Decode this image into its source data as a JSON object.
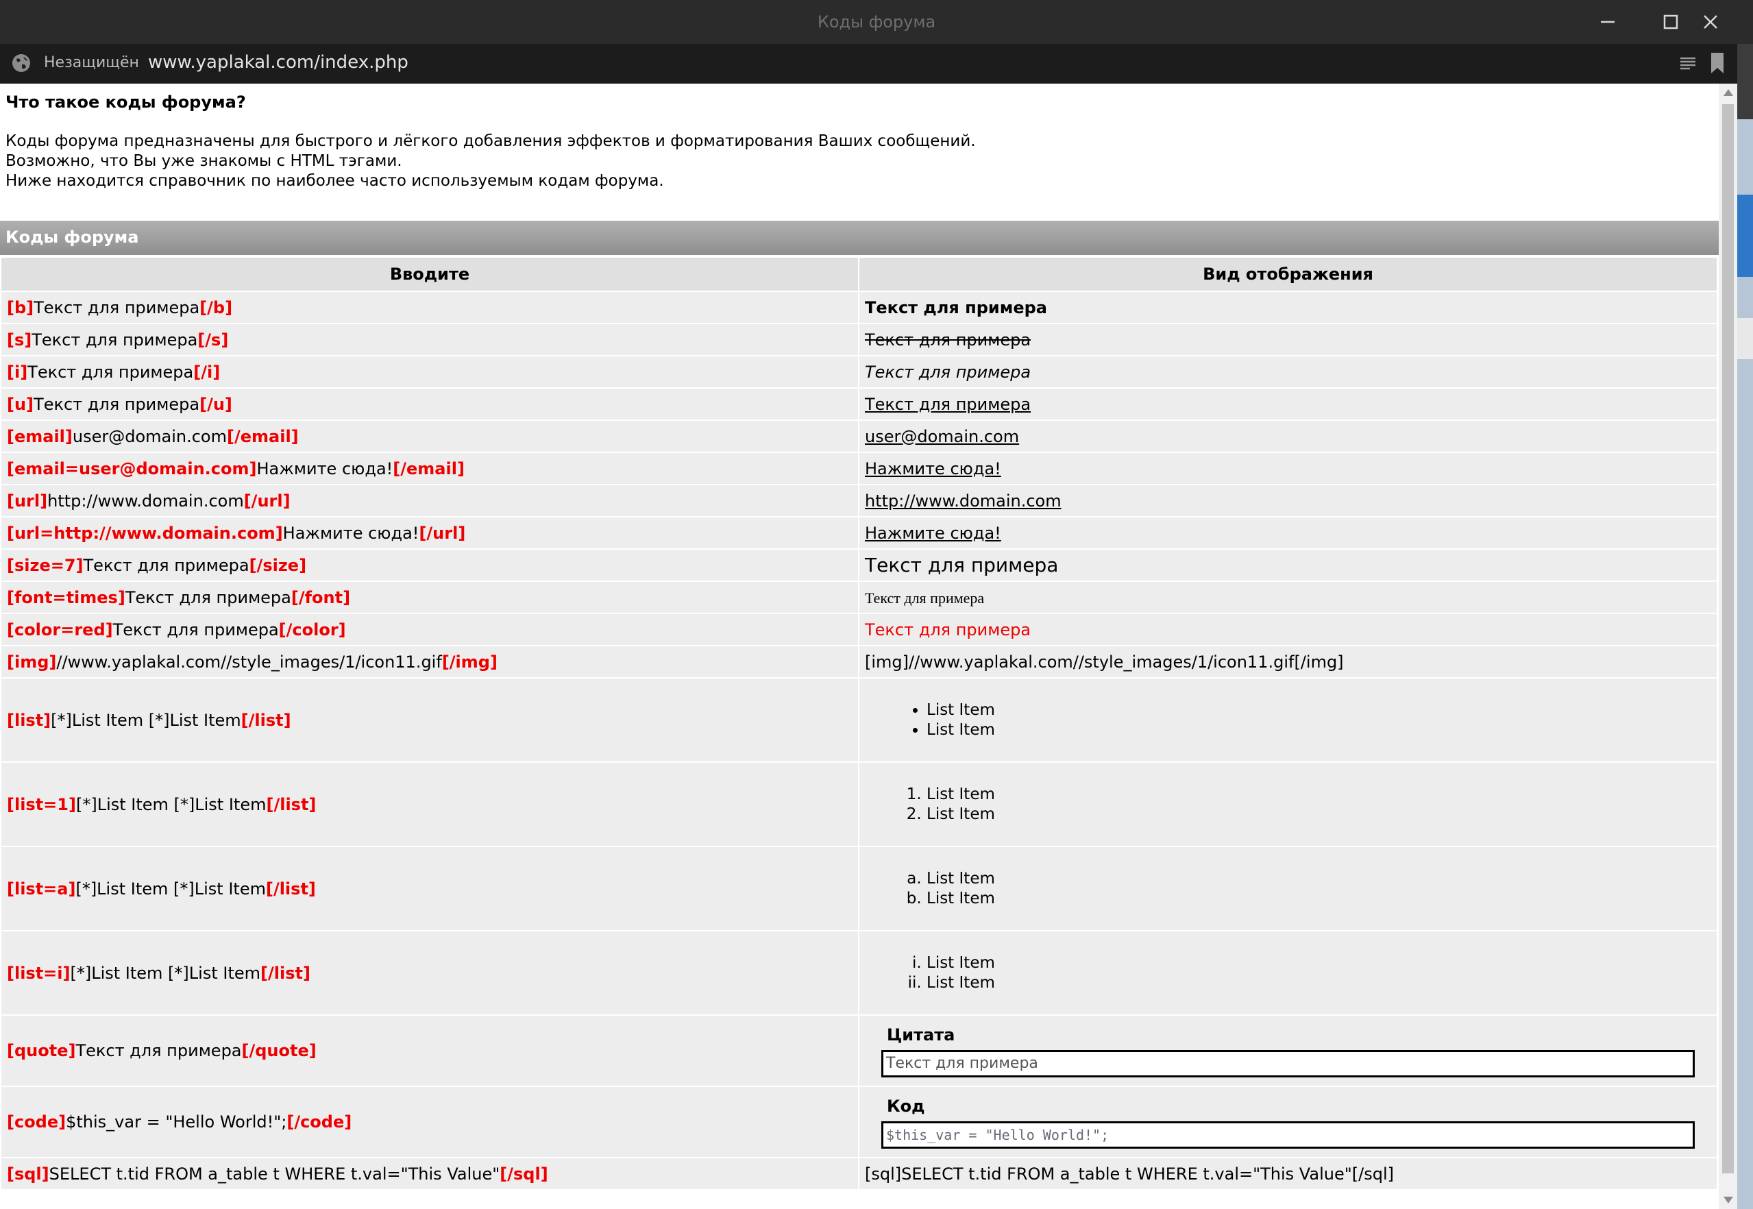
{
  "window": {
    "title": "Коды форума"
  },
  "address_bar": {
    "security_label": "Незащищён",
    "url": "www.yaplakal.com/index.php"
  },
  "intro": {
    "heading": "Что такое коды форума?",
    "paragraph_lines": [
      "Коды форума предназначены для быстрого и лёгкого добавления эффектов и форматирования Ваших сообщений.",
      "Возможно, что Вы уже знакомы с HTML тэгами.",
      "Ниже находится справочник по наиболее часто используемым кодам форума."
    ]
  },
  "section": {
    "title": "Коды форума"
  },
  "table": {
    "headers": [
      "Вводите",
      "Вид отображения"
    ],
    "rows": {
      "b": {
        "open": "[b]",
        "text": "Текст для примера",
        "close": "[/b]",
        "result": "Текст для примера"
      },
      "s": {
        "open": "[s]",
        "text": "Текст для примера",
        "close": "[/s]",
        "result": "Текст для примера"
      },
      "i": {
        "open": "[i]",
        "text": "Текст для примера",
        "close": "[/i]",
        "result": "Текст для примера"
      },
      "u": {
        "open": "[u]",
        "text": "Текст для примера",
        "close": "[/u]",
        "result": "Текст для примера"
      },
      "email1": {
        "open": "[email]",
        "text": "user@domain.com",
        "close": "[/email]",
        "result": "user@domain.com"
      },
      "email2": {
        "open": "[email=user@domain.com]",
        "text": "Нажмите сюда!",
        "close": "[/email]",
        "result": "Нажмите сюда!"
      },
      "url1": {
        "open": "[url]",
        "text": "http://www.domain.com",
        "close": "[/url]",
        "result": "http://www.domain.com"
      },
      "url2": {
        "open": "[url=http://www.domain.com]",
        "text": "Нажмите сюда!",
        "close": "[/url]",
        "result": "Нажмите сюда!"
      },
      "size": {
        "open": "[size=7]",
        "text": "Текст для примера",
        "close": "[/size]",
        "result": "Текст для примера"
      },
      "font": {
        "open": "[font=times]",
        "text": "Текст для примера",
        "close": "[/font]",
        "result": "Текст для примера"
      },
      "color": {
        "open": "[color=red]",
        "text": "Текст для примера",
        "close": "[/color]",
        "result": "Текст для примера"
      },
      "img": {
        "open": "[img]",
        "text": "//www.yaplakal.com//style_images/1/icon11.gif",
        "close": "[/img]",
        "result": "[img]//www.yaplakal.com//style_images/1/icon11.gif[/img]"
      },
      "list": {
        "open": "[list]",
        "text": "[*]List Item [*]List Item",
        "close": "[/list]",
        "items": [
          "List Item",
          "List Item"
        ]
      },
      "list1": {
        "open": "[list=1]",
        "text": "[*]List Item [*]List Item",
        "close": "[/list]",
        "items": [
          "List Item",
          "List Item"
        ]
      },
      "lista": {
        "open": "[list=a]",
        "text": "[*]List Item [*]List Item",
        "close": "[/list]",
        "items": [
          "List Item",
          "List Item"
        ]
      },
      "listi": {
        "open": "[list=i]",
        "text": "[*]List Item [*]List Item",
        "close": "[/list]",
        "items": [
          "List Item",
          "List Item"
        ]
      },
      "quote": {
        "open": "[quote]",
        "text": "Текст для примера",
        "close": "[/quote]",
        "box_title": "Цитата",
        "box_text": "Текст для примера"
      },
      "code": {
        "open": "[code]",
        "text": "$this_var = \"Hello World!\";",
        "close": "[/code]",
        "box_title": "Код",
        "box_text": "$this_var = \"Hello World!\";"
      },
      "sql": {
        "open": "[sql]",
        "text": "SELECT t.tid FROM a_table t WHERE t.val=\"This Value\"",
        "close": "[/sql]",
        "result": "[sql]SELECT t.tid FROM a_table t WHERE t.val=\"This Value\"[/sql]"
      }
    }
  },
  "colors": {
    "tag": "#ee0000",
    "titlebar": "#2b2b2b",
    "address_bar": "#1c1c1c",
    "section_head": "#9f9f9f",
    "cell": "#ededed",
    "header_cell": "#e0e0e0"
  },
  "icons": {
    "security": "globe-icon",
    "reader_view": "reader-view-icon",
    "bookmark": "bookmark-icon",
    "minimize": "minimize-icon",
    "maximize": "maximize-icon",
    "close": "close-icon"
  }
}
